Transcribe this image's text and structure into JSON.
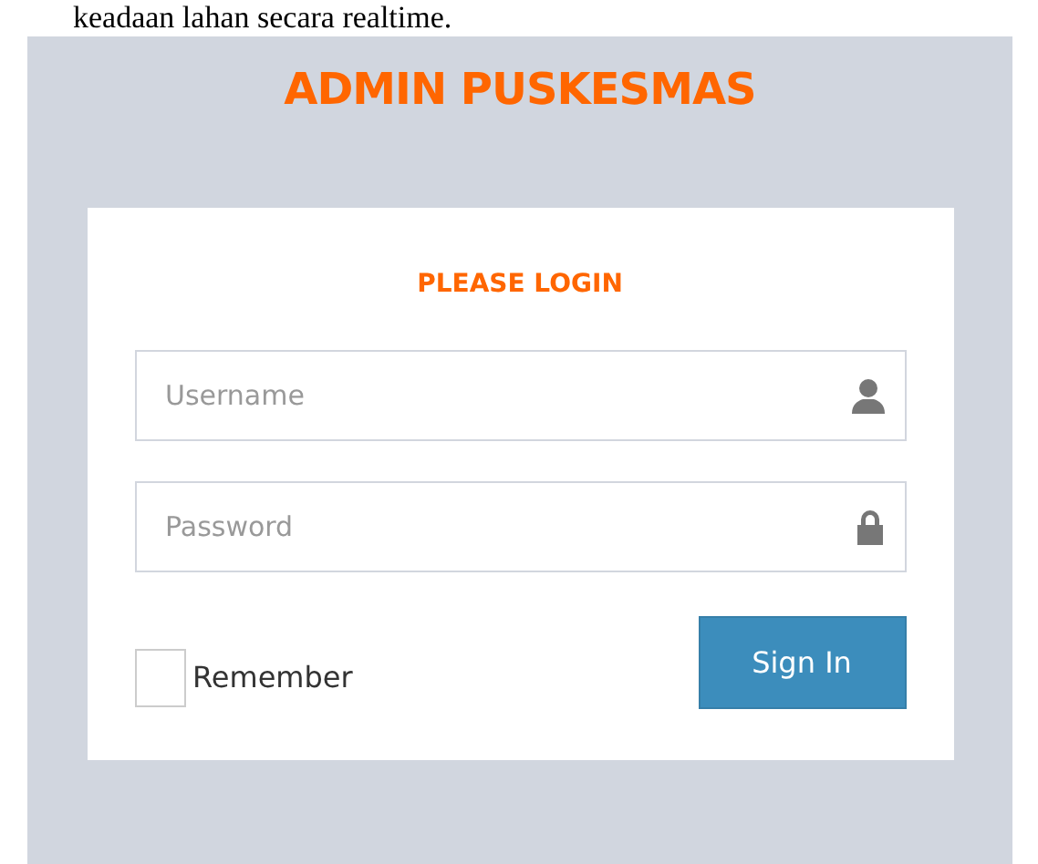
{
  "caption": "keadaan lahan secara realtime.",
  "title": "ADMIN PUSKESMAS",
  "login": {
    "heading": "PLEASE LOGIN",
    "fields": [
      {
        "kind": "username",
        "placeholder": "Username"
      },
      {
        "kind": "password",
        "placeholder": "Password"
      }
    ],
    "remember": {
      "label": "Remember",
      "checked": false
    },
    "button": "Sign In"
  }
}
